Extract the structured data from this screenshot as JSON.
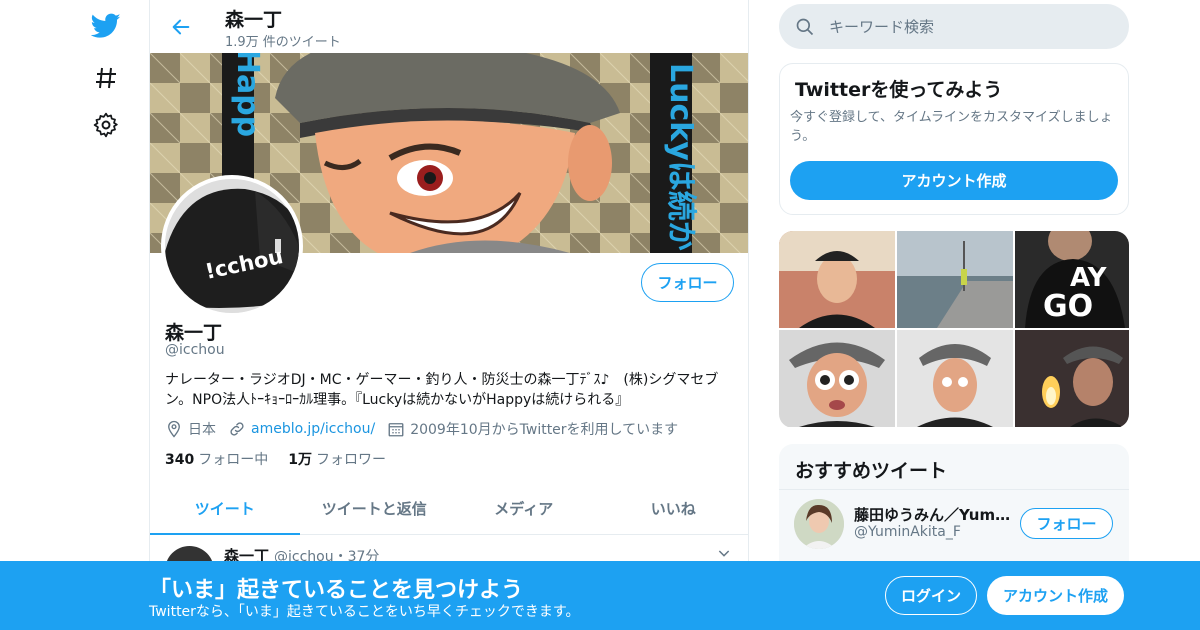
{
  "colors": {
    "accent": "#1da1f2",
    "text": "#14171a",
    "muted": "#657786",
    "border": "#e6ecf0"
  },
  "nav": {
    "icons": [
      "twitter-bird-icon",
      "hashtag-icon",
      "gear-icon"
    ]
  },
  "header": {
    "name": "森一丁",
    "tweet_count": "1.9万 件のツイート"
  },
  "banner": {
    "text_left": "Happ",
    "text_right": "Luckyは続か"
  },
  "avatar": {
    "cap_text": "!cchou"
  },
  "profile": {
    "follow_label": "フォロー",
    "name": "森一丁",
    "handle": "@icchou",
    "bio": "ナレーター・ラジオDJ・MC・ゲーマー・釣り人・防災士の森一丁ﾃﾞｽ♪　(株)シグマセブン。NPO法人ﾄｰｷｮｰﾛｰｶﾙ理事。『Luckyは続かないがHappyは続けられる』",
    "location": "日本",
    "website": "ameblo.jp/icchou/",
    "joined": "2009年10月からTwitterを利用しています",
    "following_count": "340",
    "following_label": "フォロー中",
    "followers_count": "1万",
    "followers_label": "フォロワー"
  },
  "tabs": [
    {
      "label": "ツイート",
      "active": true
    },
    {
      "label": "ツイートと返信",
      "active": false
    },
    {
      "label": "メディア",
      "active": false
    },
    {
      "label": "いいね",
      "active": false
    }
  ],
  "tweet": {
    "name": "森一丁",
    "handle_time": "@icchou・37分"
  },
  "search": {
    "placeholder": "キーワード検索"
  },
  "signup_card": {
    "title": "Twitterを使ってみよう",
    "description": "今すぐ登録して、タイムラインをカスタマイズしましょう。",
    "button": "アカウント作成"
  },
  "recommended": {
    "title": "おすすめツイート",
    "user_name": "藤田ゆうみん／Yumi…",
    "user_handle": "@YuminAkita_F",
    "follow_label": "フォロー"
  },
  "bottom_bar": {
    "title": "「いま」起きていることを見つけよう",
    "subtitle": "Twitterなら、「いま」起きていることをいち早くチェックできます。",
    "login": "ログイン",
    "signup": "アカウント作成"
  }
}
